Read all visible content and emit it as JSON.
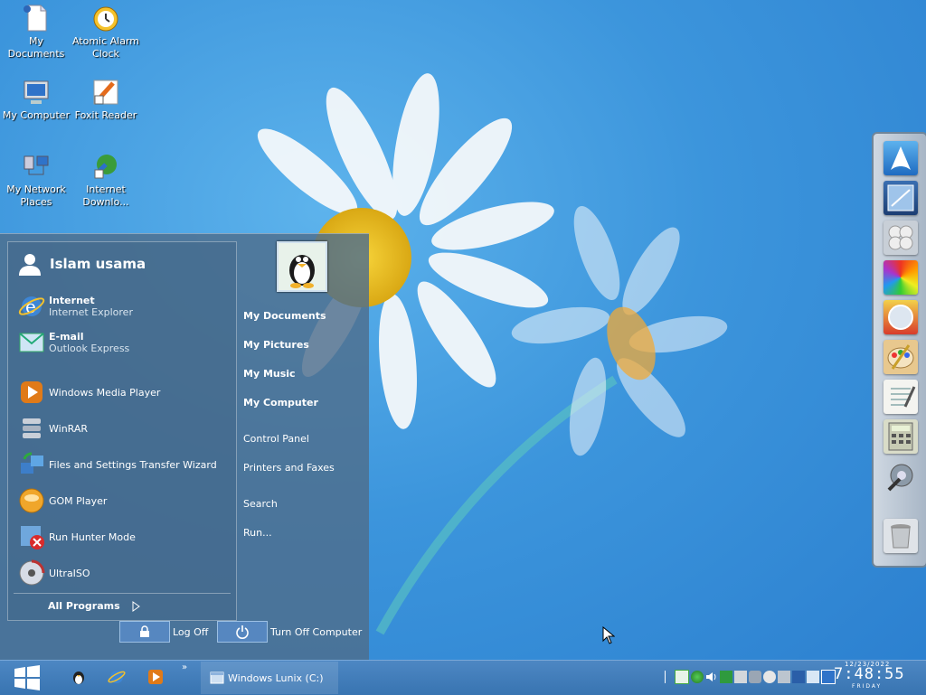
{
  "desktop": {
    "icons": [
      {
        "label": "My Documents"
      },
      {
        "label": "Atomic Alarm Clock"
      },
      {
        "label": "My Computer"
      },
      {
        "label": "Foxit Reader"
      },
      {
        "label": "My Network Places"
      },
      {
        "label": "Internet Downlo..."
      }
    ]
  },
  "start_menu": {
    "user_name": "Islam usama",
    "pinned": [
      {
        "title": "Internet",
        "subtitle": "Internet Explorer",
        "icon": "ie-icon"
      },
      {
        "title": "E-mail",
        "subtitle": "Outlook Express",
        "icon": "outlook-icon"
      }
    ],
    "recent": [
      {
        "label": "Windows Media Player",
        "icon": "wmp-icon"
      },
      {
        "label": "WinRAR",
        "icon": "winrar-icon"
      },
      {
        "label": "Files and Settings Transfer Wizard",
        "icon": "transfer-wizard-icon"
      },
      {
        "label": "GOM Player",
        "icon": "gom-icon"
      },
      {
        "label": "Run Hunter Mode",
        "icon": "hunter-icon"
      },
      {
        "label": "UltraISO",
        "icon": "ultraiso-icon"
      }
    ],
    "all_programs": "All Programs",
    "right": {
      "my_documents": "My Documents",
      "my_pictures": "My Pictures",
      "my_music": "My Music",
      "my_computer": "My Computer",
      "control_panel": "Control Panel",
      "printers": "Printers and Faxes",
      "search": "Search",
      "run": "Run..."
    },
    "log_off": "Log Off",
    "turn_off": "Turn Off Computer"
  },
  "taskbar": {
    "window_title": "Windows Lunix (C:)",
    "more": "»",
    "clock": {
      "date": "12/23/2022",
      "time": "7:48:55",
      "day": "FRIDAY"
    }
  },
  "colors": {
    "accent": "#3874b1",
    "menu": "#4e6e8c"
  }
}
